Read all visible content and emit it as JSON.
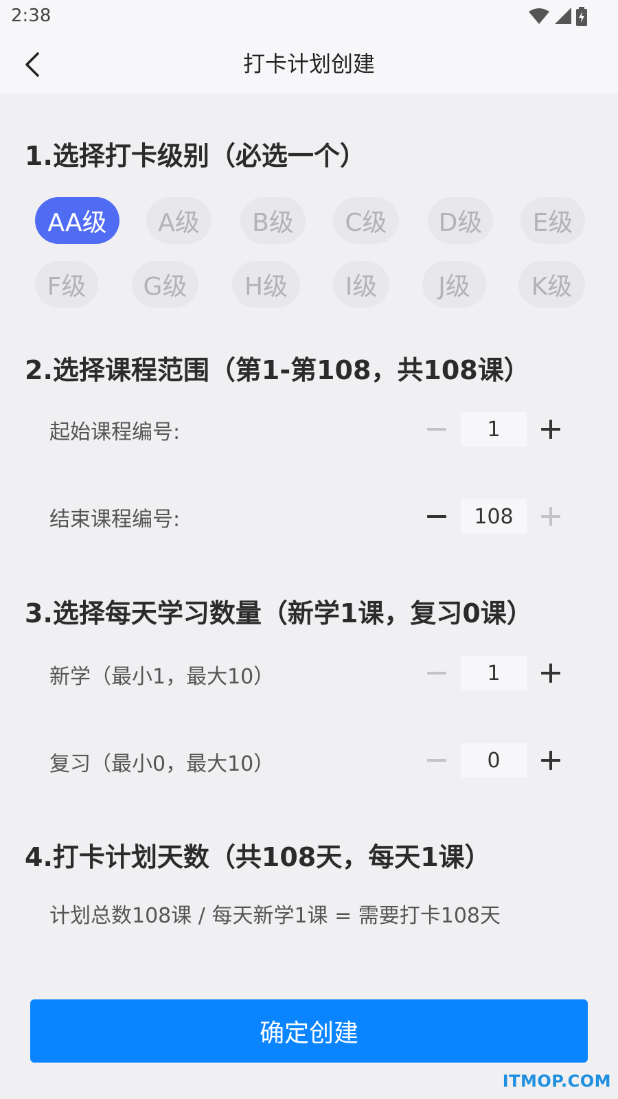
{
  "status_bar": {
    "time": "2:38"
  },
  "header": {
    "title": "打卡计划创建"
  },
  "sections": {
    "level": {
      "title": "1.选择打卡级别（必选一个）",
      "options": [
        "AA级",
        "A级",
        "B级",
        "C级",
        "D级",
        "E级",
        "F级",
        "G级",
        "H级",
        "I级",
        "J级",
        "K级"
      ],
      "selected": "AA级"
    },
    "range": {
      "title": "2.选择课程范围（第1-第108，共108课）",
      "start": {
        "label": "起始课程编号:",
        "value": "1"
      },
      "end": {
        "label": "结束课程编号:",
        "value": "108"
      }
    },
    "daily": {
      "title": "3.选择每天学习数量（新学1课，复习0课）",
      "new": {
        "label": "新学（最小1，最大10）",
        "value": "1"
      },
      "review": {
        "label": "复习（最小0，最大10）",
        "value": "0"
      }
    },
    "days": {
      "title": "4.打卡计划天数（共108天，每天1课）",
      "formula": "计划总数108课 / 每天新学1课 = 需要打卡108天"
    }
  },
  "confirm_button": {
    "label": "确定创建"
  },
  "watermark": "ITMOP.COM",
  "colors": {
    "accent": "#0a84ff",
    "selected_chip": "#4f6cf2",
    "watermark": "#1f8fe0"
  }
}
